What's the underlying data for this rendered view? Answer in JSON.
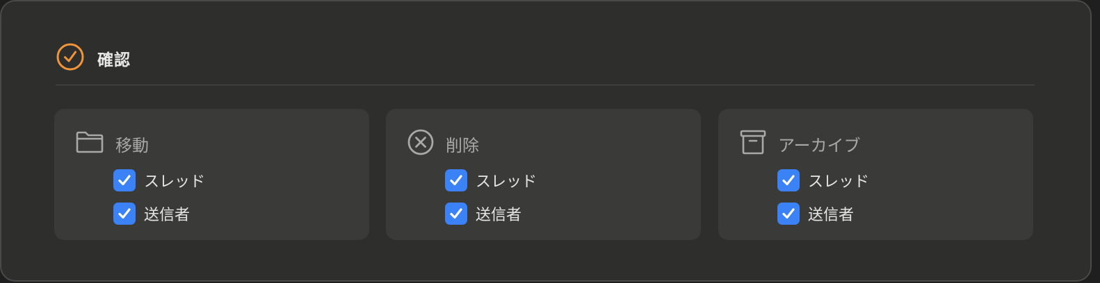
{
  "header": {
    "icon": "check-circle-icon",
    "title": "確認",
    "accent_color": "#f0953a"
  },
  "cards": [
    {
      "icon": "folder-icon",
      "title": "移動",
      "options": [
        {
          "label": "スレッド",
          "checked": true
        },
        {
          "label": "送信者",
          "checked": true
        }
      ]
    },
    {
      "icon": "x-circle-icon",
      "title": "削除",
      "options": [
        {
          "label": "スレッド",
          "checked": true
        },
        {
          "label": "送信者",
          "checked": true
        }
      ]
    },
    {
      "icon": "archive-box-icon",
      "title": "アーカイブ",
      "options": [
        {
          "label": "スレッド",
          "checked": true
        },
        {
          "label": "送信者",
          "checked": true
        }
      ]
    }
  ],
  "colors": {
    "checkbox": "#3b82f6",
    "card_background": "#3a3a38",
    "window_background": "#2e2e2c"
  }
}
